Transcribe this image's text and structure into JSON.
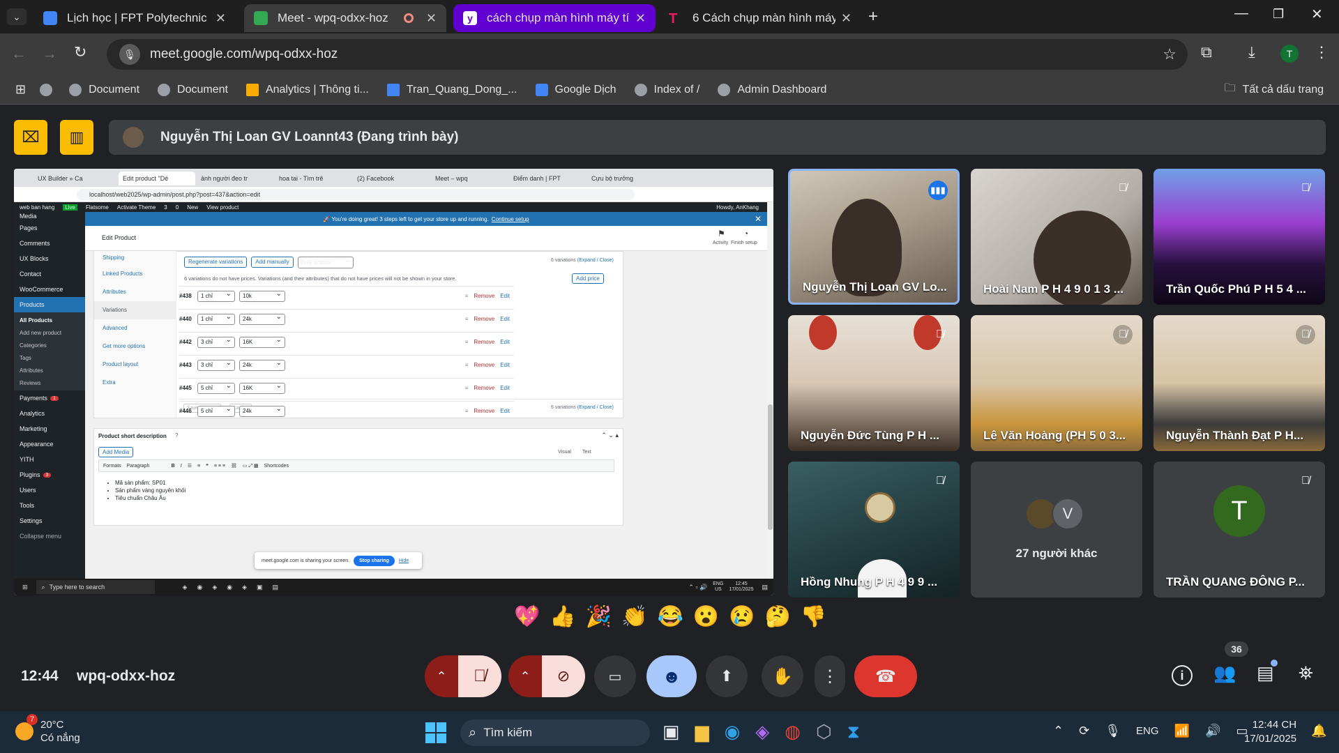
{
  "browser": {
    "tabs": [
      {
        "title": "Lịch học | FPT Polytechnic",
        "color": "#4285f4"
      },
      {
        "title": "Meet - wpq-odxx-hoz",
        "color": "#34a853"
      },
      {
        "title": "cách chụp màn hình máy tính -",
        "color": "#6001d2"
      },
      {
        "title": "6 Cách chụp màn hình máy tính",
        "color": "#e91e63"
      }
    ],
    "url": "meet.google.com/wpq-odxx-hoz",
    "profile_initial": "T",
    "bookmarks": [
      "Document",
      "Document",
      "Analytics | Thông ti...",
      "Tran_Quang_Dong_...",
      "Google Dịch",
      "Index of /",
      "Admin Dashboard"
    ],
    "all_bookmarks": "Tất cả dấu trang"
  },
  "meet": {
    "presenter": "Nguyễn Thị Loan GV Loannt43 (Đang trình bày)",
    "participants": [
      {
        "name": "Nguyễn Thị Loan GV Lo...",
        "speaking": true
      },
      {
        "name": "Hoài Nam P H 4 9 0 1 3 ...",
        "muted": true
      },
      {
        "name": "Trần Quốc Phú P H 5 4 ...",
        "muted": true
      },
      {
        "name": "Nguyễn Đức Tùng P H ...",
        "muted": true
      },
      {
        "name": "Lê Văn Hoàng (PH 5 0 3...",
        "muted": true
      },
      {
        "name": "Nguyễn Thành Đạt P H...",
        "muted": true
      },
      {
        "name": "Hồng Nhung P H 4 9 9 ...",
        "muted": true
      },
      {
        "name": "27 người khác",
        "avatar_letter": "V"
      },
      {
        "name": "TRẦN QUANG ĐÔNG P...",
        "avatar_letter": "T",
        "muted": true
      }
    ],
    "reactions": [
      "💖",
      "👍",
      "🎉",
      "👏",
      "😂",
      "😮",
      "😢",
      "🤔",
      "👎"
    ],
    "time": "12:44",
    "meeting_code": "wpq-odxx-hoz",
    "participant_count": "36"
  },
  "shared": {
    "tabs": [
      "UX Builder » Ca",
      "Edit product \"Dé",
      "ảnh người đeo tr",
      "hoa tai - Tìm trê",
      "(2) Facebook",
      "Meet – wpq",
      "Điểm danh | FPT",
      "Cựu bộ trưởng"
    ],
    "url": "localhost/web2025/wp-admin/post.php?post=437&action=edit",
    "adminbar": {
      "site": "web ban hang",
      "live": "Live",
      "flatsome": "Flatsome",
      "activate": "Activate Theme",
      "updates": "3",
      "comments": "0",
      "new": "New",
      "view": "View product",
      "howdy": "Howdy, AnKhang"
    },
    "notice": {
      "text": "🚀 You're doing great! 3 steps left to get your store up and running.",
      "link": "Continue setup"
    },
    "page_title": "Edit Product",
    "activity": "Activity",
    "finish_setup": "Finish setup",
    "sidebar": [
      "Media",
      "Pages",
      "Comments",
      "UX Blocks",
      "Contact",
      "WooCommerce",
      "Products",
      "Payments",
      "Analytics",
      "Marketing",
      "Appearance",
      "YITH",
      "Plugins",
      "Users",
      "Tools",
      "Settings",
      "Collapse menu"
    ],
    "products_sub": [
      "All Products",
      "Add new product",
      "Categories",
      "Tags",
      "Attributes",
      "Reviews"
    ],
    "payments_badge": "1",
    "plugins_badge": "3",
    "product_tabs": [
      "Shipping",
      "Linked Products",
      "Attributes",
      "Variations",
      "Advanced",
      "Get more options",
      "Product layout",
      "Extra"
    ],
    "regen": "Regenerate variations",
    "add_manually": "Add manually",
    "bulk": "Bulk actions",
    "var_count": "6 variations",
    "expand_close": "(Expand / Close)",
    "no_price_note": "6 variations do not have prices. Variations (and their attributes) that do not have prices will not be shown in your store.",
    "add_price": "Add price",
    "variations": [
      {
        "id": "#438",
        "a": "1 chỉ",
        "b": "10k"
      },
      {
        "id": "#440",
        "a": "1 chỉ",
        "b": "24k"
      },
      {
        "id": "#442",
        "a": "3 chỉ",
        "b": "16K"
      },
      {
        "id": "#443",
        "a": "3 chỉ",
        "b": "24k"
      },
      {
        "id": "#445",
        "a": "5 chỉ",
        "b": "16K"
      },
      {
        "id": "#446",
        "a": "5 chỉ",
        "b": "24k"
      }
    ],
    "remove": "Remove",
    "edit": "Edit",
    "save_changes": "Save changes",
    "cancel": "Cancel",
    "short_desc": "Product short description",
    "add_media": "Add Media",
    "visual": "Visual",
    "text": "Text",
    "formats": "Formats",
    "paragraph": "Paragraph",
    "shortcodes": "Shortcodes",
    "desc_items": [
      "Mã sản phẩm: SP01",
      "Sản phẩm vàng nguyên khối",
      "Tiêu chuẩn Châu Âu"
    ],
    "sharing_text": "meet.google.com is sharing your screen.",
    "stop_sharing": "Stop sharing",
    "hide": "Hide",
    "search": "Type here to search",
    "tray_lang": "ENG",
    "tray_region": "US",
    "tray_time": "12:45",
    "tray_date": "17/01/2025"
  },
  "taskbar": {
    "weather_temp": "20°C",
    "weather_desc": "Có nắng",
    "weather_badge": "7",
    "search": "Tìm kiếm",
    "lang": "ENG",
    "time": "12:44 CH",
    "date": "17/01/2025"
  }
}
